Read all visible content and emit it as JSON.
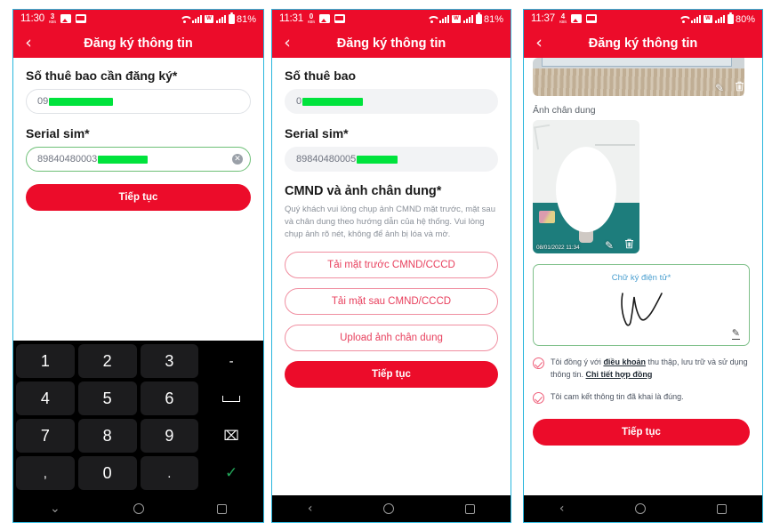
{
  "app": {
    "title": "Đăng ký thông tin",
    "accent_red": "#ec0c2a",
    "accent_green": "#00e33c",
    "outline_pink": "#f08ea0",
    "panel_border": "#29b6dd"
  },
  "panels": [
    {
      "status": {
        "time": "11:30",
        "rate_num": "3",
        "rate_unit": "KB/s",
        "battery": "81%"
      },
      "header": {
        "back": "‹",
        "title": "Đăng ký thông tin"
      },
      "form": {
        "phone_label": "Số thuê bao cần đăng ký*",
        "phone_value": "09",
        "serial_label": "Serial sim*",
        "serial_value": "89840480003",
        "clear_icon": "✕",
        "submit": "Tiếp tục"
      },
      "keyboard": {
        "rows": [
          [
            "1",
            "2",
            "3",
            "-"
          ],
          [
            "4",
            "5",
            "6",
            "space"
          ],
          [
            "7",
            "8",
            "9",
            "⌧"
          ],
          [
            ",",
            "0",
            ".",
            "✓"
          ]
        ]
      },
      "nav": {
        "back": "⌄",
        "home": "circle",
        "recent": "square"
      }
    },
    {
      "status": {
        "time": "11:31",
        "rate_num": "0",
        "rate_unit": "KB/s",
        "battery": "81%"
      },
      "header": {
        "back": "‹",
        "title": "Đăng ký thông tin"
      },
      "form": {
        "phone_label": "Số thuê bao",
        "phone_value": "0",
        "serial_label": "Serial sim*",
        "serial_value": "89840480005",
        "section_title": "CMND và ảnh chân dung*",
        "section_desc": "Quý khách vui lòng chụp ảnh CMND mặt trước, mặt sau và chân dung theo hướng dẫn của hệ thống. Vui lòng chụp ảnh rõ nét, không để ảnh bị lóa và mờ.",
        "upload_front": "Tải mặt trước CMND/CCCD",
        "upload_back": "Tải mặt sau CMND/CCCD",
        "upload_portrait": "Upload ảnh chân dung",
        "submit": "Tiếp tục"
      },
      "nav": {
        "back": "‹",
        "home": "circle",
        "recent": "square"
      }
    },
    {
      "status": {
        "time": "11:37",
        "rate_num": "4",
        "rate_unit": "KB/s",
        "battery": "80%"
      },
      "header": {
        "back": "‹",
        "title": "Đăng ký thông tin"
      },
      "media": {
        "idcard_edit_icon": "✎",
        "idcard_delete_icon": "Ὕ1",
        "portrait_label": "Ảnh chân dung",
        "portrait_timestamp": "08/01/2022 11:34",
        "portrait_edit_icon": "✎",
        "portrait_delete_icon": "Ὕ1"
      },
      "signature": {
        "title": "Chữ ký điện tử*",
        "edit_icon": "✎"
      },
      "consents": [
        {
          "text_before": "Tôi đồng ý với ",
          "link1": "điều khoản",
          "text_mid": " thu thập, lưu trữ và sử dụng thông tin. ",
          "link2": "Chi tiết hợp đồng",
          "text_after": ""
        },
        {
          "text_before": "Tôi cam kết thông tin đã khai là đúng.",
          "link1": "",
          "text_mid": "",
          "link2": "",
          "text_after": ""
        }
      ],
      "submit": "Tiếp tục",
      "nav": {
        "back": "‹",
        "home": "circle",
        "recent": "square"
      }
    }
  ]
}
